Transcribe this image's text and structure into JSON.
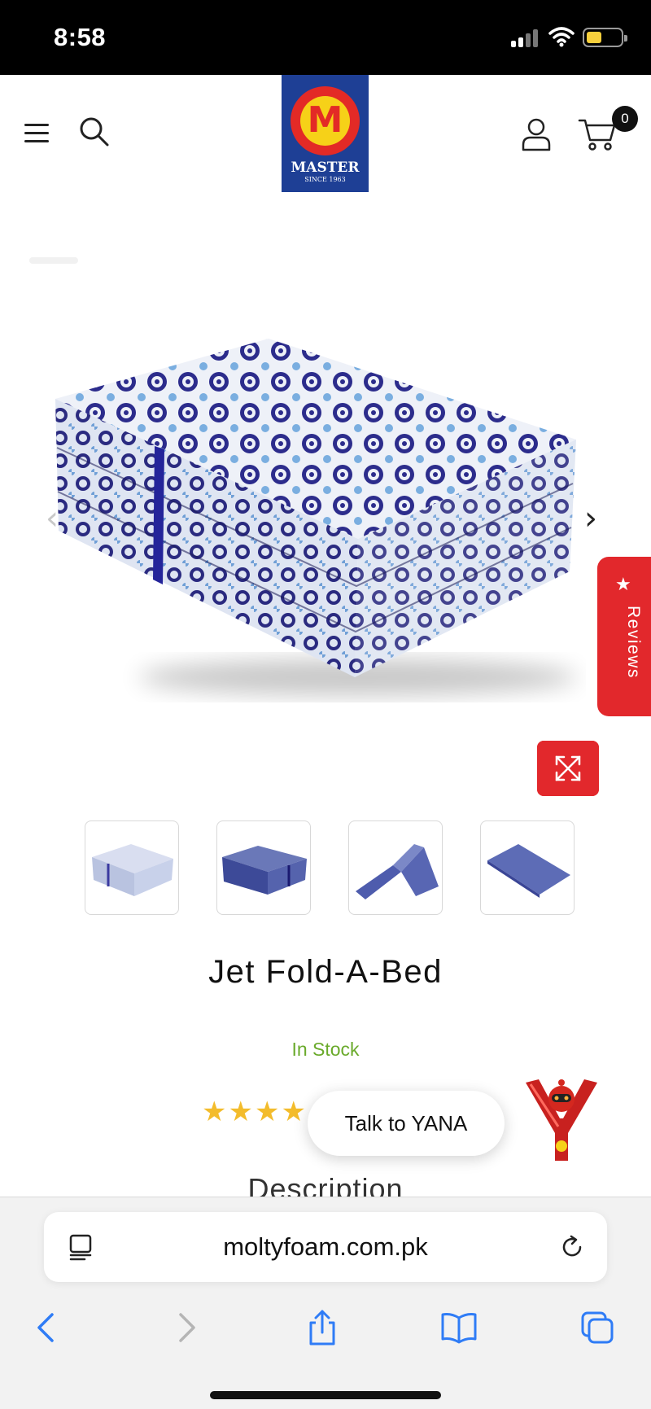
{
  "status_bar": {
    "time": "8:58"
  },
  "header": {
    "logo": {
      "letter": "M",
      "name": "MASTER",
      "since": "SINCE 1963"
    },
    "cart_count": "0"
  },
  "gallery": {
    "thumbnail_count": 4,
    "pattern_colors": {
      "navy": "#2c2c8c",
      "light_blue": "#7aaee0",
      "base": "#eef1f8"
    }
  },
  "reviews_tab": {
    "label": "Reviews"
  },
  "product": {
    "title": "Jet Fold-A-Bed",
    "stock": "In Stock",
    "stars": "★★★★",
    "section_heading": "Description"
  },
  "chat": {
    "label": "Talk to YANA"
  },
  "browser": {
    "url": "moltyfoam.com.pk"
  },
  "colors": {
    "accent_red": "#e2282c",
    "brand_blue": "#1e3f95",
    "stock_green": "#6aaa2b",
    "star_gold": "#f3bc2c"
  }
}
